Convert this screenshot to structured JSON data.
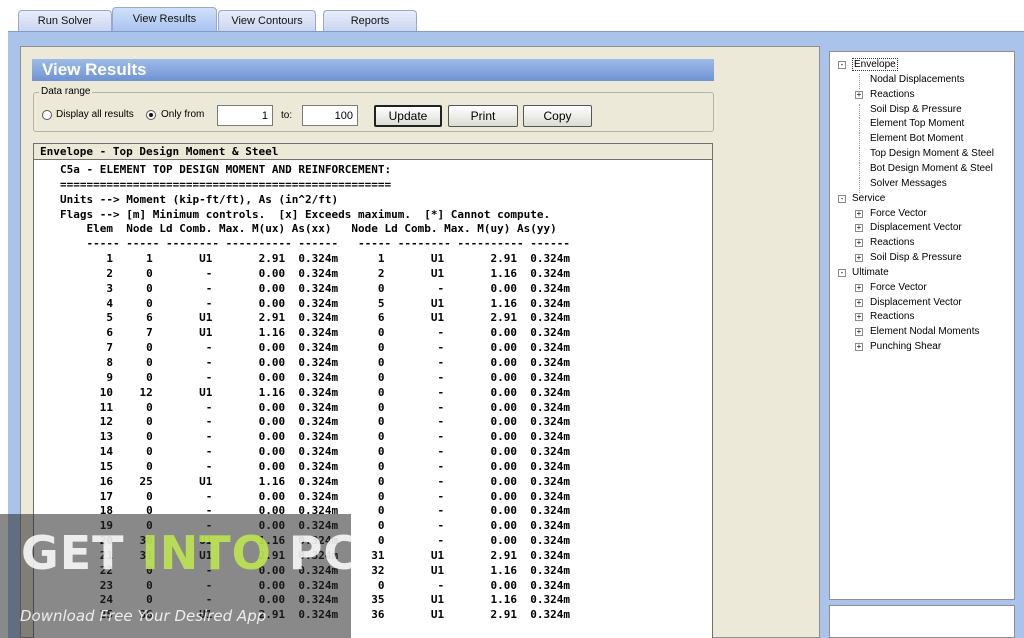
{
  "tabs": [
    {
      "label": "Run Solver"
    },
    {
      "label": "View Results"
    },
    {
      "label": "View Contours"
    },
    {
      "label": "Reports"
    }
  ],
  "panel": {
    "title": "View Results"
  },
  "data_range": {
    "legend": "Data range",
    "display_all_label": "Display all results",
    "only_from_label": "Only from",
    "from_value": "1",
    "to_label": "to:",
    "to_value": "100",
    "update_label": "Update",
    "print_label": "Print",
    "copy_label": "Copy"
  },
  "report": {
    "title": "Envelope - Top Design Moment & Steel",
    "lines": [
      "C5a - ELEMENT TOP DESIGN MOMENT AND REINFORCEMENT:",
      "==================================================",
      "Units --> Moment (kip-ft/ft), As (in^2/ft)",
      "Flags --> [m] Minimum controls.  [x] Exceeds maximum.  [*] Cannot compute.",
      "    Elem  Node Ld Comb. Max. M(ux) As(xx)   Node Ld Comb. Max. M(uy) As(yy)",
      "    ----- ----- -------- ---------- ------   ----- -------- ---------- ------"
    ],
    "rows": [
      [
        "1",
        "1",
        "U1",
        "2.91",
        "0.324m",
        "1",
        "U1",
        "2.91",
        "0.324m"
      ],
      [
        "2",
        "0",
        "-",
        "0.00",
        "0.324m",
        "2",
        "U1",
        "1.16",
        "0.324m"
      ],
      [
        "3",
        "0",
        "-",
        "0.00",
        "0.324m",
        "0",
        "-",
        "0.00",
        "0.324m"
      ],
      [
        "4",
        "0",
        "-",
        "0.00",
        "0.324m",
        "5",
        "U1",
        "1.16",
        "0.324m"
      ],
      [
        "5",
        "6",
        "U1",
        "2.91",
        "0.324m",
        "6",
        "U1",
        "2.91",
        "0.324m"
      ],
      [
        "6",
        "7",
        "U1",
        "1.16",
        "0.324m",
        "0",
        "-",
        "0.00",
        "0.324m"
      ],
      [
        "7",
        "0",
        "-",
        "0.00",
        "0.324m",
        "0",
        "-",
        "0.00",
        "0.324m"
      ],
      [
        "8",
        "0",
        "-",
        "0.00",
        "0.324m",
        "0",
        "-",
        "0.00",
        "0.324m"
      ],
      [
        "9",
        "0",
        "-",
        "0.00",
        "0.324m",
        "0",
        "-",
        "0.00",
        "0.324m"
      ],
      [
        "10",
        "12",
        "U1",
        "1.16",
        "0.324m",
        "0",
        "-",
        "0.00",
        "0.324m"
      ],
      [
        "11",
        "0",
        "-",
        "0.00",
        "0.324m",
        "0",
        "-",
        "0.00",
        "0.324m"
      ],
      [
        "12",
        "0",
        "-",
        "0.00",
        "0.324m",
        "0",
        "-",
        "0.00",
        "0.324m"
      ],
      [
        "13",
        "0",
        "-",
        "0.00",
        "0.324m",
        "0",
        "-",
        "0.00",
        "0.324m"
      ],
      [
        "14",
        "0",
        "-",
        "0.00",
        "0.324m",
        "0",
        "-",
        "0.00",
        "0.324m"
      ],
      [
        "15",
        "0",
        "-",
        "0.00",
        "0.324m",
        "0",
        "-",
        "0.00",
        "0.324m"
      ],
      [
        "16",
        "25",
        "U1",
        "1.16",
        "0.324m",
        "0",
        "-",
        "0.00",
        "0.324m"
      ],
      [
        "17",
        "0",
        "-",
        "0.00",
        "0.324m",
        "0",
        "-",
        "0.00",
        "0.324m"
      ],
      [
        "18",
        "0",
        "-",
        "0.00",
        "0.324m",
        "0",
        "-",
        "0.00",
        "0.324m"
      ],
      [
        "19",
        "0",
        "-",
        "0.00",
        "0.324m",
        "0",
        "-",
        "0.00",
        "0.324m"
      ],
      [
        "20",
        "30",
        "U1",
        "1.16",
        "0.324m",
        "0",
        "-",
        "0.00",
        "0.324m"
      ],
      [
        "21",
        "31",
        "U1",
        "2.91",
        "0.324m",
        "31",
        "U1",
        "2.91",
        "0.324m"
      ],
      [
        "22",
        "0",
        "-",
        "0.00",
        "0.324m",
        "32",
        "U1",
        "1.16",
        "0.324m"
      ],
      [
        "23",
        "0",
        "-",
        "0.00",
        "0.324m",
        "0",
        "-",
        "0.00",
        "0.324m"
      ],
      [
        "24",
        "0",
        "-",
        "0.00",
        "0.324m",
        "35",
        "U1",
        "1.16",
        "0.324m"
      ],
      [
        "25",
        "36",
        "U1",
        "2.91",
        "0.324m",
        "36",
        "U1",
        "2.91",
        "0.324m"
      ]
    ]
  },
  "tree": [
    {
      "label": "Envelope",
      "level": 0,
      "expander": "-",
      "selected": true
    },
    {
      "label": "Nodal Displacements",
      "level": 1,
      "expander": ""
    },
    {
      "label": "Reactions",
      "level": 1,
      "expander": "+"
    },
    {
      "label": "Soil Disp & Pressure",
      "level": 1,
      "expander": ""
    },
    {
      "label": "Element Top Moment",
      "level": 1,
      "expander": ""
    },
    {
      "label": "Element Bot Moment",
      "level": 1,
      "expander": ""
    },
    {
      "label": "Top Design Moment & Steel",
      "level": 1,
      "expander": ""
    },
    {
      "label": "Bot Design Moment & Steel",
      "level": 1,
      "expander": ""
    },
    {
      "label": "Solver Messages",
      "level": 1,
      "expander": ""
    },
    {
      "label": "Service",
      "level": 0,
      "expander": "-"
    },
    {
      "label": "Force Vector",
      "level": 1,
      "expander": "+"
    },
    {
      "label": "Displacement Vector",
      "level": 1,
      "expander": "+"
    },
    {
      "label": "Reactions",
      "level": 1,
      "expander": "+"
    },
    {
      "label": "Soil Disp & Pressure",
      "level": 1,
      "expander": "+"
    },
    {
      "label": "Ultimate",
      "level": 0,
      "expander": "-"
    },
    {
      "label": "Force Vector",
      "level": 1,
      "expander": "+"
    },
    {
      "label": "Displacement Vector",
      "level": 1,
      "expander": "+"
    },
    {
      "label": "Reactions",
      "level": 1,
      "expander": "+"
    },
    {
      "label": "Element Nodal Moments",
      "level": 1,
      "expander": "+"
    },
    {
      "label": "Punching Shear",
      "level": 1,
      "expander": "+"
    }
  ],
  "watermark": {
    "main_get": "GET",
    "main_into": "INTO",
    "main_pc": "PC",
    "sub": "Download Free Your Desired App"
  },
  "colors": {
    "frame": "#a9c3ea",
    "panel": "#ece9d8",
    "title_bar": "#7f9fd9"
  }
}
